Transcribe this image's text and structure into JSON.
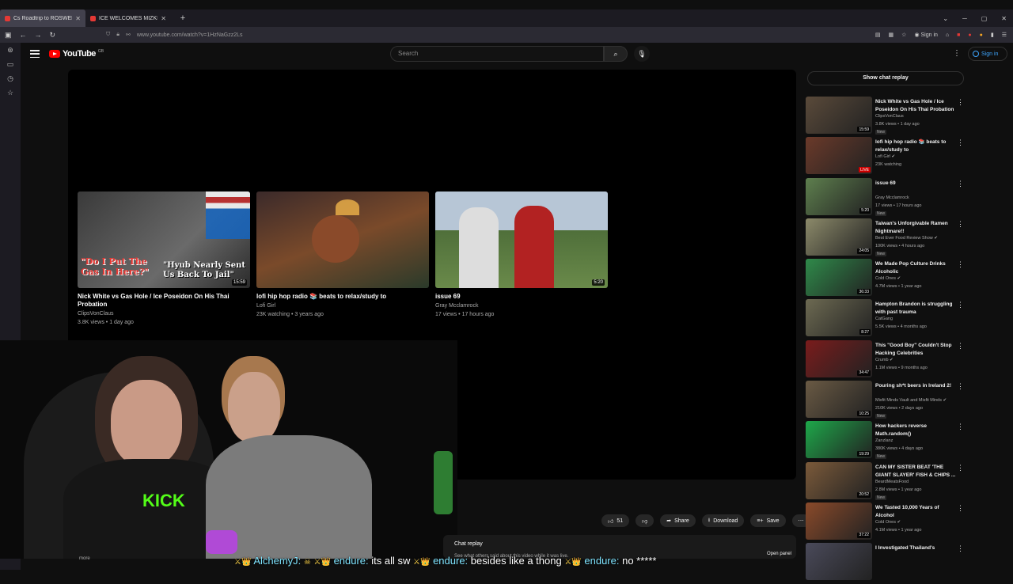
{
  "browser": {
    "tabs": [
      {
        "label": "Cs Roadtrip to ROSWELL",
        "active": true
      },
      {
        "label": "ICE WELCOMES MIZKIF + XENA",
        "active": false
      }
    ],
    "url": "www.youtube.com/watch?v=1HzNaGzz2Ls",
    "signin": "Sign in"
  },
  "header": {
    "logo": "YouTube",
    "logo_cc": "GB",
    "search_placeholder": "Search",
    "signin": "Sign in"
  },
  "endscreen": [
    {
      "title": "Nick White vs Gas Hole / Ice Poseidon On His Thai Probation",
      "channel": "ClipsVonClaus",
      "meta": "3.8K views • 1 day ago",
      "duration": "15:59",
      "overlay1": "\"Do I Put The",
      "overlay2": "Gas In Here?\"",
      "overlay3": "\"Hyub Nearly Sent",
      "overlay4": "Us Back To Jail\""
    },
    {
      "title": "lofi hip hop radio 📚 beats to relax/study to",
      "channel": "Lofi Girl",
      "meta": "23K watching • 3 years ago",
      "duration": ""
    },
    {
      "title": "issue 69",
      "channel": "Gray Mcclamrock",
      "meta": "17 views • 17 hours ago",
      "duration": "5:20"
    }
  ],
  "actions": {
    "likes": "51",
    "share": "Share",
    "download": "Download",
    "save": "Save"
  },
  "chat": {
    "title": "Chat replay",
    "subtitle": "See what others said about this video while it was live.",
    "open_panel": "Open panel",
    "show_chat_replay": "Show chat replay"
  },
  "description_more": "more",
  "stream_chat": {
    "user1": "AlchemyJ:",
    "msg1": "its all sw",
    "user2": "endure:",
    "msg2": "its all sw",
    "user3": "endure:",
    "msg3": "besides like a thong",
    "user4": "endure:",
    "msg4": "no *****"
  },
  "recommendations": [
    {
      "title": "Nick White vs Gas Hole / Ice Poseidon On His Thai Probation",
      "channel": "ClipsVonClaus",
      "meta": "3.8K views • 1 day ago",
      "badge": "New",
      "duration": "15:59",
      "color": "#5a4a3a"
    },
    {
      "title": "lofi hip hop radio 📚 beats to relax/study to",
      "channel": "Lofi Girl ✔",
      "meta": "23K watching",
      "badge": "",
      "duration": "LIVE",
      "color": "#6b3a2a"
    },
    {
      "title": "issue 69",
      "channel": "Gray Mcclamrock",
      "meta": "17 views • 17 hours ago",
      "badge": "New",
      "duration": "5:20",
      "color": "#5e7f4e"
    },
    {
      "title": "Taiwan's Unforgivable Ramen Nightmare!!",
      "channel": "Best Ever Food Review Show ✔",
      "meta": "100K views • 4 hours ago",
      "badge": "New",
      "duration": "24:05",
      "color": "#8c8a6a"
    },
    {
      "title": "We Made Pop Culture Drinks Alcoholic",
      "channel": "Cold Ones ✔",
      "meta": "4.7M views • 1 year ago",
      "badge": "",
      "duration": "36:33",
      "color": "#2f8a4a"
    },
    {
      "title": "Hampton Brandon is struggling with past trauma",
      "channel": "CatGang",
      "meta": "5.5K views • 4 months ago",
      "badge": "",
      "duration": "8:27",
      "color": "#6d6a52"
    },
    {
      "title": "This \"Good Boy\" Couldn't Stop Hacking Celebrities",
      "channel": "Crumb ✔",
      "meta": "1.1M views • 9 months ago",
      "badge": "",
      "duration": "34:47",
      "color": "#7a1c1c"
    },
    {
      "title": "Pouring sh*t beers in Ireland 2!",
      "channel": "Misfit Minds Vault and Misfit Minds ✔",
      "meta": "210K views • 2 days ago",
      "badge": "New",
      "duration": "10:25",
      "color": "#6a5a44"
    },
    {
      "title": "How hackers reverse Math.random()",
      "channel": "Zanzlanz",
      "meta": "380K views • 4 days ago",
      "badge": "New",
      "duration": "19:29",
      "color": "#1ea84a"
    },
    {
      "title": "CAN MY SISTER BEAT 'THE GIANT SLAYER' FISH & CHIPS ...",
      "channel": "BeardMeatsFood",
      "meta": "2.8M views • 1 year ago",
      "badge": "New",
      "duration": "20:52",
      "color": "#7b5a3a"
    },
    {
      "title": "We Tasted 10,000 Years of Alcohol",
      "channel": "Cold Ones ✔",
      "meta": "4.1M views • 1 year ago",
      "badge": "",
      "duration": "37:22",
      "color": "#8a4a2a"
    },
    {
      "title": "I Investigated Thailand's",
      "channel": "",
      "meta": "",
      "badge": "",
      "duration": "",
      "color": "#4a4a5a"
    }
  ]
}
